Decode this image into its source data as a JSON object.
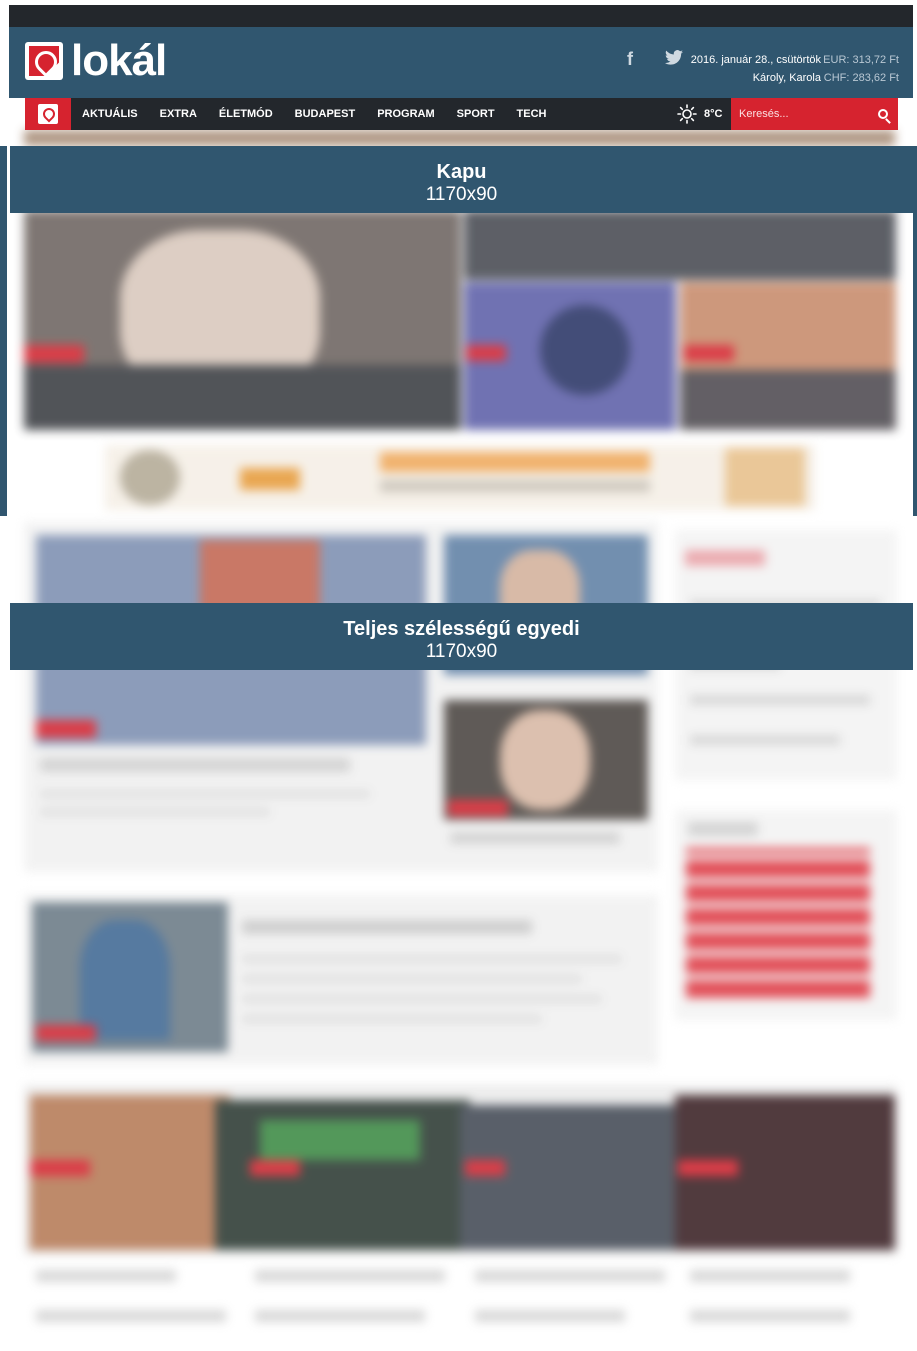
{
  "header": {
    "logo_text": "lokál",
    "date": "2016. január 28., csütörtök",
    "nameday": "Károly, Karola",
    "eur": "EUR: 313,72 Ft",
    "chf": "CHF: 283,62 Ft"
  },
  "social": {
    "facebook": "f",
    "twitter": "t"
  },
  "nav": {
    "items": [
      "AKTUÁLIS",
      "EXTRA",
      "ÉLETMÓD",
      "BUDAPEST",
      "PROGRAM",
      "SPORT",
      "TECH"
    ],
    "weather": "8°C",
    "search_placeholder": "Keresés..."
  },
  "ads": [
    {
      "title": "Kapu",
      "size": "1170x90"
    },
    {
      "title": "Teljes szélességű egyedi",
      "size": "1170x90"
    }
  ],
  "colors": {
    "brand_blue": "#30566f",
    "brand_red": "#d6232f",
    "dark": "#23272c"
  }
}
